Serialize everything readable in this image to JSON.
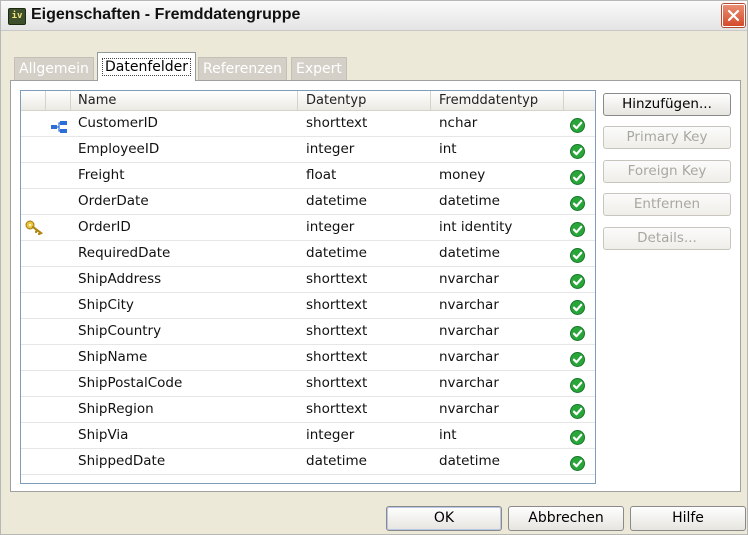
{
  "window": {
    "title": "Eigenschaften - Fremddatengruppe",
    "app_icon_text": "iv"
  },
  "tabs": [
    {
      "label": "Allgemein",
      "active": false
    },
    {
      "label": "Datenfelder",
      "active": true
    },
    {
      "label": "Referenzen",
      "active": false
    },
    {
      "label": "Expert",
      "active": false
    }
  ],
  "grid": {
    "columns": [
      "Name",
      "Datentyp",
      "Fremddatentyp"
    ],
    "rows": [
      {
        "icon": "relation-icon",
        "name": "CustomerID",
        "type": "shorttext",
        "ftype": "nchar",
        "status": "ok"
      },
      {
        "icon": "",
        "name": "EmployeeID",
        "type": "integer",
        "ftype": "int",
        "status": "ok"
      },
      {
        "icon": "",
        "name": "Freight",
        "type": "float",
        "ftype": "money",
        "status": "ok"
      },
      {
        "icon": "",
        "name": "OrderDate",
        "type": "datetime",
        "ftype": "datetime",
        "status": "ok"
      },
      {
        "icon": "key-icon",
        "name": "OrderID",
        "type": "integer",
        "ftype": "int identity",
        "status": "ok"
      },
      {
        "icon": "",
        "name": "RequiredDate",
        "type": "datetime",
        "ftype": "datetime",
        "status": "ok"
      },
      {
        "icon": "",
        "name": "ShipAddress",
        "type": "shorttext",
        "ftype": "nvarchar",
        "status": "ok"
      },
      {
        "icon": "",
        "name": "ShipCity",
        "type": "shorttext",
        "ftype": "nvarchar",
        "status": "ok"
      },
      {
        "icon": "",
        "name": "ShipCountry",
        "type": "shorttext",
        "ftype": "nvarchar",
        "status": "ok"
      },
      {
        "icon": "",
        "name": "ShipName",
        "type": "shorttext",
        "ftype": "nvarchar",
        "status": "ok"
      },
      {
        "icon": "",
        "name": "ShipPostalCode",
        "type": "shorttext",
        "ftype": "nvarchar",
        "status": "ok"
      },
      {
        "icon": "",
        "name": "ShipRegion",
        "type": "shorttext",
        "ftype": "nvarchar",
        "status": "ok"
      },
      {
        "icon": "",
        "name": "ShipVia",
        "type": "integer",
        "ftype": "int",
        "status": "ok"
      },
      {
        "icon": "",
        "name": "ShippedDate",
        "type": "datetime",
        "ftype": "datetime",
        "status": "ok"
      }
    ]
  },
  "side_buttons": {
    "add": {
      "label": "Hinzufügen...",
      "enabled": true
    },
    "primary_key": {
      "label": "Primary Key",
      "enabled": false
    },
    "foreign_key": {
      "label": "Foreign Key",
      "enabled": false
    },
    "remove": {
      "label": "Entfernen",
      "enabled": false
    },
    "details": {
      "label": "Details...",
      "enabled": false
    }
  },
  "footer": {
    "ok": "OK",
    "cancel": "Abbrechen",
    "help": "Hilfe"
  },
  "colors": {
    "check_green": "#2aa53a",
    "close_red": "#d54a2b",
    "grid_border": "#7f9db9"
  }
}
